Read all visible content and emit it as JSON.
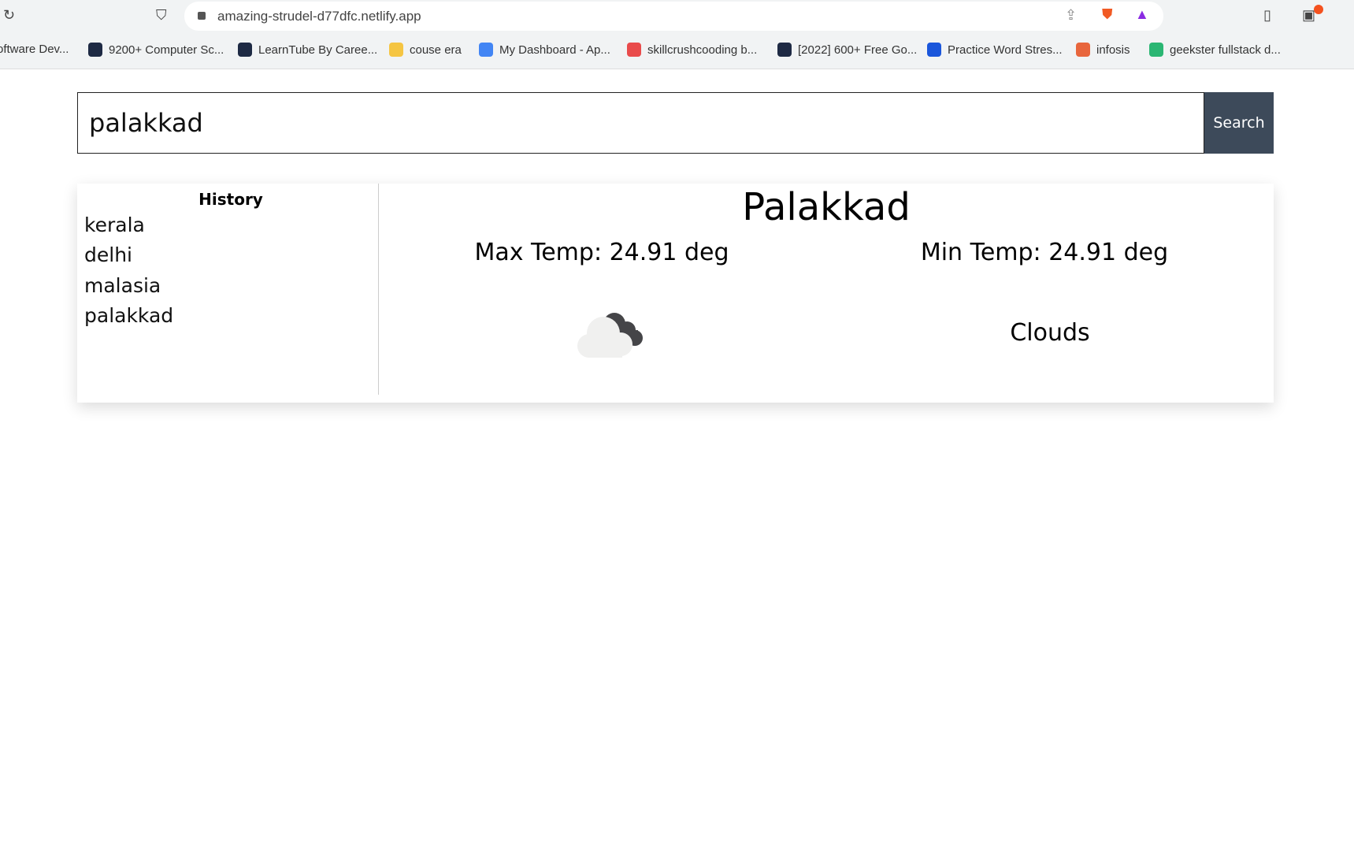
{
  "browser": {
    "url": "amazing-strudel-d77dfc.netlify.app",
    "bookmarks": [
      {
        "label": "oftware Dev...",
        "color": "#ffffff"
      },
      {
        "label": "9200+ Computer Sc...",
        "color": "#1e2a44"
      },
      {
        "label": "LearnTube By Caree...",
        "color": "#1e2a44"
      },
      {
        "label": "couse era",
        "color": "#f5c542"
      },
      {
        "label": "My Dashboard - Ap...",
        "color": "#4285f4"
      },
      {
        "label": "skillcrushcooding b...",
        "color": "#e94b4b"
      },
      {
        "label": "[2022] 600+ Free Go...",
        "color": "#1e2a44"
      },
      {
        "label": "Practice Word Stres...",
        "color": "#1a56db"
      },
      {
        "label": "infosis",
        "color": "#e8663d"
      },
      {
        "label": "geekster fullstack d...",
        "color": "#2bb673"
      }
    ]
  },
  "search": {
    "value": "palakkad",
    "button": "Search"
  },
  "history": {
    "title": "History",
    "items": [
      "kerala",
      "delhi",
      "malasia",
      "palakkad"
    ]
  },
  "weather": {
    "city": "Palakkad",
    "max_temp": "Max Temp: 24.91 deg",
    "min_temp": "Min Temp: 24.91 deg",
    "description": "Clouds",
    "icon": "broken-clouds-icon"
  }
}
